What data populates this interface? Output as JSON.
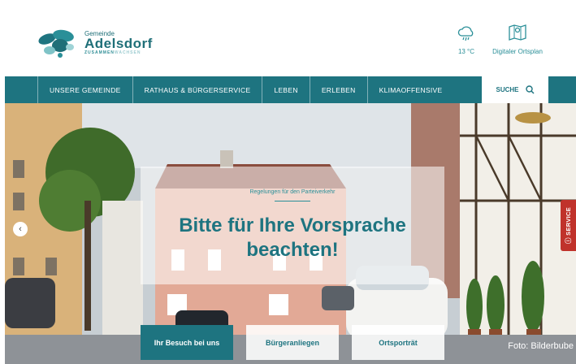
{
  "logo": {
    "small": "Gemeinde",
    "big": "Adelsdorf",
    "tag_main": "ZUSAMMEN",
    "tag_light": "WACHSEN"
  },
  "weather": {
    "icon": "rain-cloud-icon",
    "temp": "13 °C"
  },
  "ortsplan": {
    "icon": "map-icon",
    "label": "Digitaler Ortsplan"
  },
  "nav": {
    "items": [
      {
        "label": "UNSERE GEMEINDE"
      },
      {
        "label": "RATHAUS & BÜRGERSERVICE"
      },
      {
        "label": "LEBEN"
      },
      {
        "label": "ERLEBEN"
      },
      {
        "label": "KLIMAOFFENSIVE"
      }
    ],
    "search_label": "SUCHE",
    "search_icon": "search-icon"
  },
  "hero": {
    "subtitle": "Regelungen für den Parteiverkehr",
    "title": "Bitte für Ihre Vorsprache beachten!",
    "credit": "Foto: Bilderbube"
  },
  "buttons": {
    "visit": "Ihr Besuch bei uns",
    "citizen": "Bürgeranliegen",
    "portrait": "Ortsporträt"
  },
  "service": {
    "label": "SERVICE",
    "icon": "info-icon"
  },
  "colors": {
    "primary": "#1e7480",
    "accent": "#2a8f98",
    "service": "#c0322b"
  }
}
